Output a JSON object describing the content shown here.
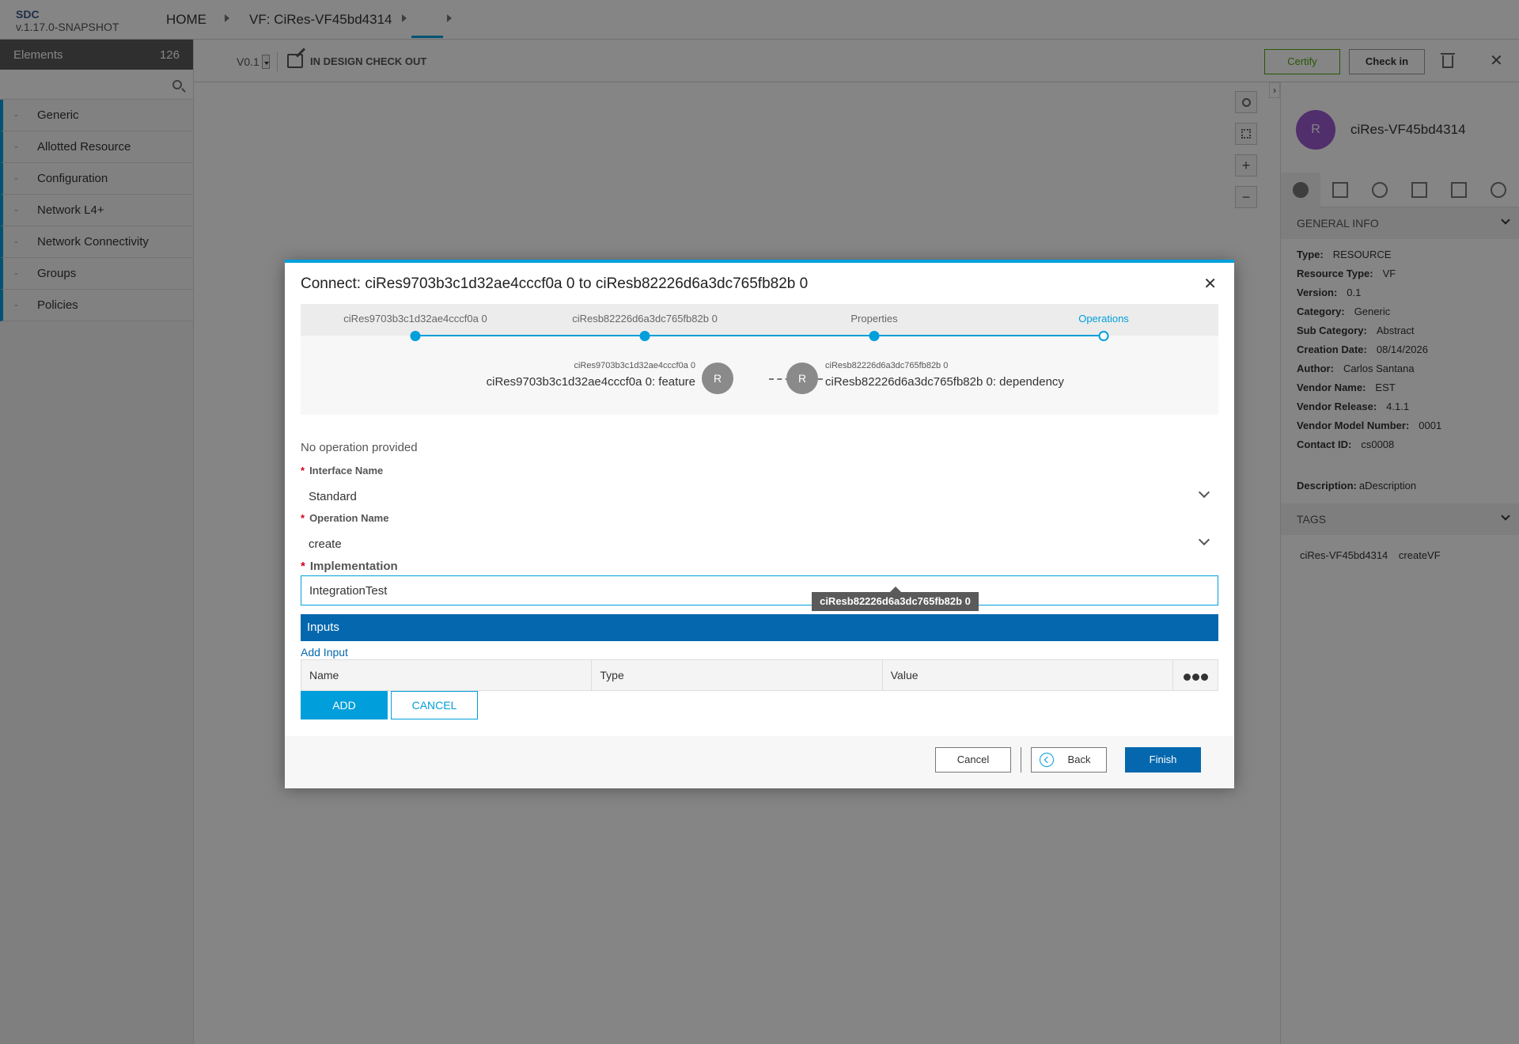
{
  "header": {
    "brand": "SDC",
    "version": "v.1.17.0-SNAPSHOT",
    "breadcrumb": [
      "HOME",
      "VF: CiRes-VF45bd4314"
    ]
  },
  "toolbar": {
    "version_select": "V0.1",
    "status": "IN DESIGN CHECK OUT",
    "certify": "Certify",
    "check_in": "Check in",
    "close": "✕"
  },
  "palette": {
    "title": "Elements",
    "count": "126",
    "search_placeholder": "",
    "items": [
      "Generic",
      "Allotted Resource",
      "Configuration",
      "Network L4+",
      "Network Connectivity",
      "Groups",
      "Policies"
    ]
  },
  "canvas": {
    "zoom_plus": "+",
    "zoom_minus": "−"
  },
  "right_panel": {
    "avatar_letter": "R",
    "title": "ciRes-VF45bd4314",
    "general_info_label": "GENERAL INFO",
    "info": [
      {
        "label": "Type:",
        "value": "RESOURCE"
      },
      {
        "label": "Resource Type:",
        "value": "VF"
      },
      {
        "label": "Version:",
        "value": "0.1"
      },
      {
        "label": "Category:",
        "value": "Generic"
      },
      {
        "label": "Sub Category:",
        "value": "Abstract"
      },
      {
        "label": "Creation Date:",
        "value": "08/14/2026"
      },
      {
        "label": "Author:",
        "value": "Carlos Santana"
      },
      {
        "label": "Vendor Name:",
        "value": "EST"
      },
      {
        "label": "Vendor Release:",
        "value": "4.1.1"
      },
      {
        "label": "Vendor Model Number:",
        "value": "0001"
      },
      {
        "label": "Contact ID:",
        "value": "cs0008"
      }
    ],
    "description": {
      "label": "Description:",
      "value": "aDescription"
    },
    "tags_label": "TAGS",
    "tags": [
      "ciRes-VF45bd4314",
      "createVF"
    ]
  },
  "modal": {
    "title": "Connect: ciRes9703b3c1d32ae4cccf0a 0 to ciResb82226d6a3dc765fb82b 0",
    "close": "✕",
    "steps": [
      {
        "label": "ciRes9703b3c1d32ae4cccf0a 0",
        "state": "done"
      },
      {
        "label": "ciResb82226d6a3dc765fb82b 0",
        "state": "done"
      },
      {
        "label": "Properties",
        "state": "done"
      },
      {
        "label": "Operations",
        "state": "active"
      }
    ],
    "connection": {
      "left_small": "ciRes9703b3c1d32ae4cccf0a 0",
      "left_big": "ciRes9703b3c1d32ae4cccf0a 0: feature",
      "left_node": "R",
      "right_node": "R",
      "right_small": "ciResb82226d6a3dc765fb82b 0",
      "right_big": "ciResb82226d6a3dc765fb82b 0: dependency"
    },
    "no_operation": "No operation provided",
    "interface_label": "Interface Name",
    "interface_value": "Standard",
    "operation_label": "Operation Name",
    "operation_value": "create",
    "implementation_label": "Implementation",
    "implementation_value": "IntegrationTest",
    "tooltip": "ciResb82226d6a3dc765fb82b 0",
    "inputs_label": "Inputs",
    "add_input": "Add Input",
    "table_headers": [
      "Name",
      "Type",
      "Value"
    ],
    "add_btn": "ADD",
    "cancel_btn": "CANCEL",
    "footer": {
      "cancel": "Cancel",
      "back": "Back",
      "finish": "Finish"
    }
  }
}
